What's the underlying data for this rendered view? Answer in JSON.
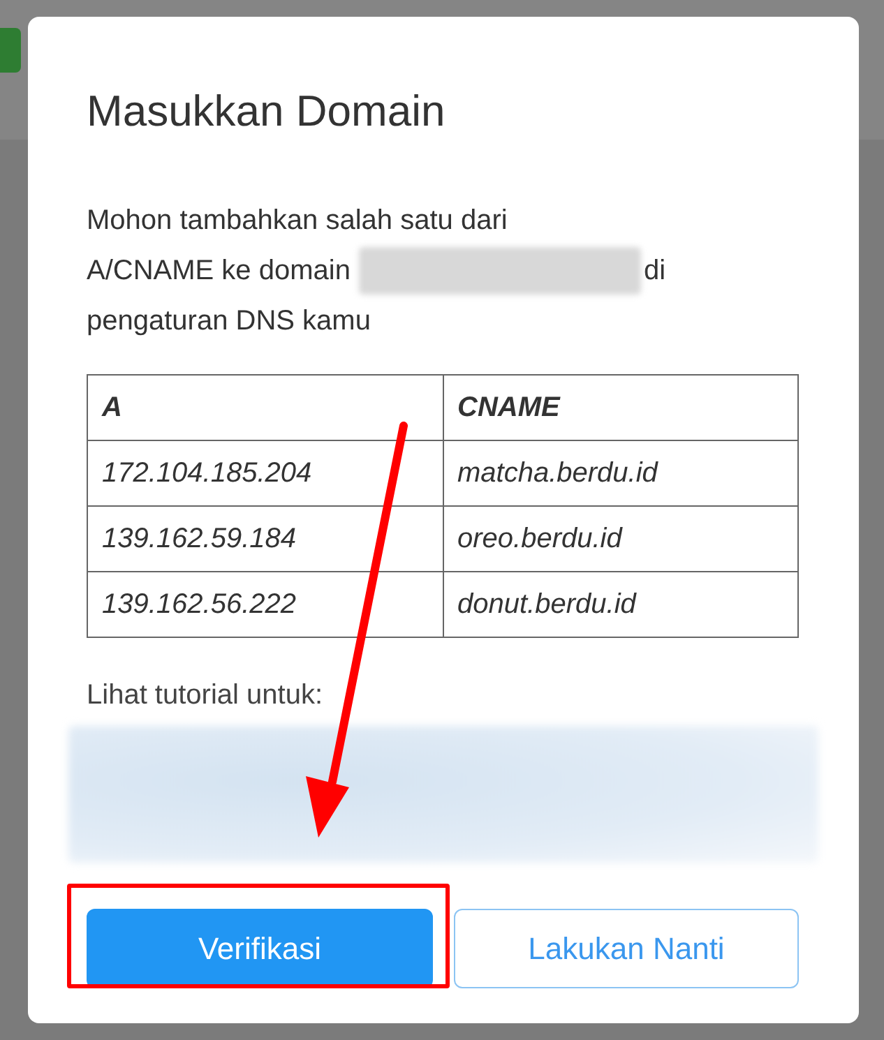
{
  "background": {
    "badge": true
  },
  "dialog": {
    "title": "Masukkan Domain",
    "instruction_lines": [
      "Mohon tambahkan salah satu dari",
      "A/CNAME ke domain",
      "di",
      "pengaturan DNS kamu"
    ],
    "table": {
      "columns": [
        "A",
        "CNAME"
      ],
      "rows": [
        [
          "172.104.185.204",
          "matcha.berdu.id"
        ],
        [
          "139.162.59.184",
          "oreo.berdu.id"
        ],
        [
          "139.162.56.222",
          "donut.berdu.id"
        ]
      ]
    },
    "tutorial_label": "Lihat tutorial untuk:",
    "buttons": [
      {
        "label": "Verifikasi",
        "kind": "primary"
      },
      {
        "label": "Lakukan Nanti",
        "kind": "outline"
      }
    ]
  }
}
